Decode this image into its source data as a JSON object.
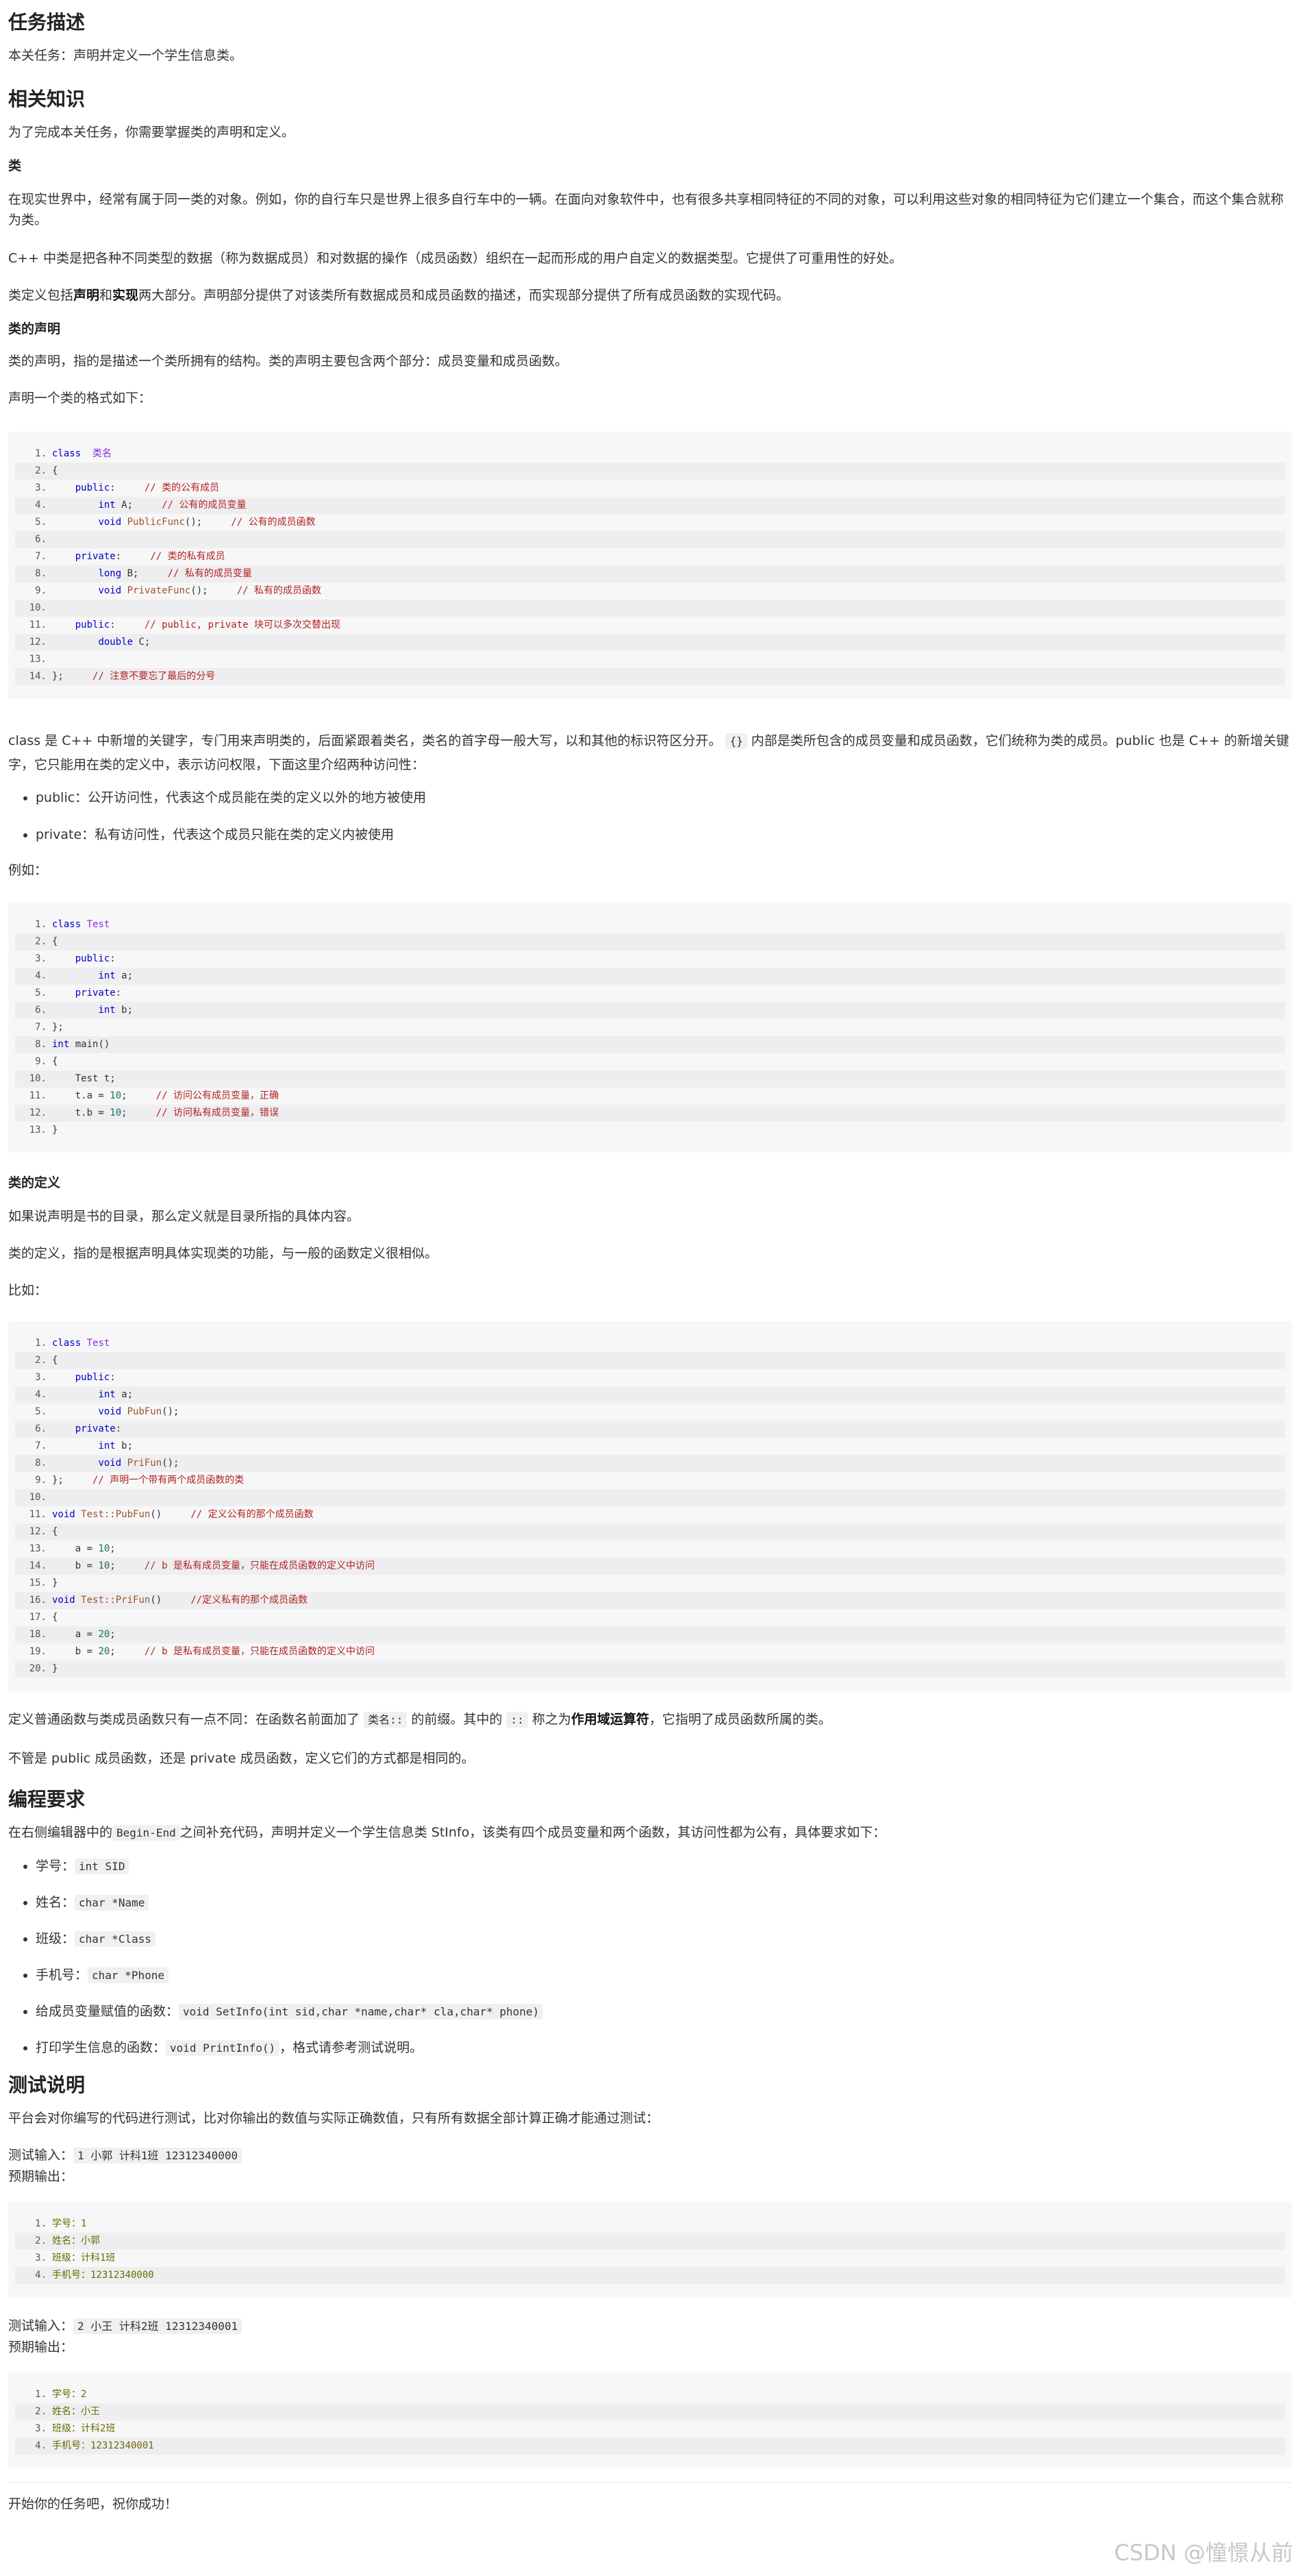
{
  "h_task": "任务描述",
  "p_task": "本关任务：声明并定义一个学生信息类。",
  "h_know": "相关知识",
  "p_know": "为了完成本关任务，你需要掌握类的声明和定义。",
  "h_class": "类",
  "p_class1": "在现实世界中，经常有属于同一类的对象。例如，你的自行车只是世界上很多自行车中的一辆。在面向对象软件中，也有很多共享相同特征的不同的对象，可以利用这些对象的相同特征为它们建立一个集合，而这个集合就称为类。",
  "p_class2": "C++ 中类是把各种不同类型的数据（称为数据成员）和对数据的操作（成员函数）组织在一起而形成的用户自定义的数据类型。它提供了可重用性的好处。",
  "p_class3a": "类定义包括",
  "p_class3b": "声明",
  "p_class3c": "和",
  "p_class3d": "实现",
  "p_class3e": "两大部分。声明部分提供了对该类所有数据成员和成员函数的描述，而实现部分提供了所有成员函数的实现代码。",
  "h_decl": "类的声明",
  "p_decl1": "类的声明，指的是描述一个类所拥有的结构。类的声明主要包含两个部分：成员变量和成员函数。",
  "p_decl2": "声明一个类的格式如下：",
  "code1": [
    {
      "n": "1.",
      "t": [
        [
          "kw",
          "class"
        ],
        [
          "",
          "  "
        ],
        [
          "ty",
          "类名"
        ]
      ]
    },
    {
      "n": "2.",
      "t": [
        [
          "",
          "{"
        ]
      ]
    },
    {
      "n": "3.",
      "t": [
        [
          "",
          "    "
        ],
        [
          "kw",
          "public"
        ],
        [
          "",
          ":     "
        ],
        [
          "cm",
          "// 类的公有成员"
        ]
      ]
    },
    {
      "n": "4.",
      "t": [
        [
          "",
          "        "
        ],
        [
          "kw",
          "int"
        ],
        [
          "",
          " A;     "
        ],
        [
          "cm",
          "// 公有的成员变量"
        ]
      ]
    },
    {
      "n": "5.",
      "t": [
        [
          "",
          "        "
        ],
        [
          "kw",
          "void"
        ],
        [
          "",
          " "
        ],
        [
          "fn",
          "PublicFunc"
        ],
        [
          "",
          "();     "
        ],
        [
          "cm",
          "// 公有的成员函数"
        ]
      ]
    },
    {
      "n": "6.",
      "t": [
        [
          "",
          ""
        ]
      ]
    },
    {
      "n": "7.",
      "t": [
        [
          "",
          "    "
        ],
        [
          "kw",
          "private"
        ],
        [
          "",
          ":     "
        ],
        [
          "cm",
          "// 类的私有成员"
        ]
      ]
    },
    {
      "n": "8.",
      "t": [
        [
          "",
          "        "
        ],
        [
          "kw",
          "long"
        ],
        [
          "",
          " B;     "
        ],
        [
          "cm",
          "// 私有的成员变量"
        ]
      ]
    },
    {
      "n": "9.",
      "t": [
        [
          "",
          "        "
        ],
        [
          "kw",
          "void"
        ],
        [
          "",
          " "
        ],
        [
          "fn",
          "PrivateFunc"
        ],
        [
          "",
          "();     "
        ],
        [
          "cm",
          "// 私有的成员函数"
        ]
      ]
    },
    {
      "n": "10.",
      "t": [
        [
          "",
          ""
        ]
      ]
    },
    {
      "n": "11.",
      "t": [
        [
          "",
          "    "
        ],
        [
          "kw",
          "public"
        ],
        [
          "",
          ":     "
        ],
        [
          "cm",
          "// public, private 块可以多次交替出现"
        ]
      ]
    },
    {
      "n": "12.",
      "t": [
        [
          "",
          "        "
        ],
        [
          "kw",
          "double"
        ],
        [
          "",
          " C;"
        ]
      ]
    },
    {
      "n": "13.",
      "t": [
        [
          "",
          ""
        ]
      ]
    },
    {
      "n": "14.",
      "t": [
        [
          "",
          "};     "
        ],
        [
          "cm",
          "// 注意不要忘了最后的分号"
        ]
      ]
    }
  ],
  "p_kw1": "class 是 C++ 中新增的关键字，专门用来声明类的，后面紧跟着类名，类名的首字母一般大写，以和其他的标识符区分开。",
  "p_kw_ic": "{}",
  "p_kw2": " 内部是类所包含的成员变量和成员函数，它们统称为类的成员。public 也是 C++ 的新增关键字，它只能用在类的定义中，表示访问权限，下面这里介绍两种访问性：",
  "li_public": "public：公开访问性，代表这个成员能在类的定义以外的地方被使用",
  "li_private": "private：私有访问性，代表这个成员只能在类的定义内被使用",
  "p_eg": "例如：",
  "code2": [
    {
      "n": "1.",
      "t": [
        [
          "kw",
          "class"
        ],
        [
          "",
          " "
        ],
        [
          "ty",
          "Test"
        ]
      ]
    },
    {
      "n": "2.",
      "t": [
        [
          "",
          "{"
        ]
      ]
    },
    {
      "n": "3.",
      "t": [
        [
          "",
          "    "
        ],
        [
          "kw",
          "public"
        ],
        [
          "",
          ":"
        ]
      ]
    },
    {
      "n": "4.",
      "t": [
        [
          "",
          "        "
        ],
        [
          "kw",
          "int"
        ],
        [
          "",
          " a;"
        ]
      ]
    },
    {
      "n": "5.",
      "t": [
        [
          "",
          "    "
        ],
        [
          "kw",
          "private"
        ],
        [
          "",
          ":"
        ]
      ]
    },
    {
      "n": "6.",
      "t": [
        [
          "",
          "        "
        ],
        [
          "kw",
          "int"
        ],
        [
          "",
          " b;"
        ]
      ]
    },
    {
      "n": "7.",
      "t": [
        [
          "",
          "};"
        ]
      ]
    },
    {
      "n": "8.",
      "t": [
        [
          "kw",
          "int"
        ],
        [
          "",
          " main()"
        ]
      ]
    },
    {
      "n": "9.",
      "t": [
        [
          "",
          "{"
        ]
      ]
    },
    {
      "n": "10.",
      "t": [
        [
          "",
          "    Test t;"
        ]
      ]
    },
    {
      "n": "11.",
      "t": [
        [
          "",
          "    t.a = "
        ],
        [
          "nm",
          "10"
        ],
        [
          "",
          ";     "
        ],
        [
          "cm",
          "// 访问公有成员变量，正确"
        ]
      ]
    },
    {
      "n": "12.",
      "t": [
        [
          "",
          "    t.b = "
        ],
        [
          "nm",
          "10"
        ],
        [
          "",
          ";     "
        ],
        [
          "cm",
          "// 访问私有成员变量，错误"
        ]
      ]
    },
    {
      "n": "13.",
      "t": [
        [
          "",
          "}"
        ]
      ]
    }
  ],
  "h_def": "类的定义",
  "p_def1": "如果说声明是书的目录，那么定义就是目录所指的具体内容。",
  "p_def2": "类的定义，指的是根据声明具体实现类的功能，与一般的函数定义很相似。",
  "p_def3": "比如：",
  "code3": [
    {
      "n": "1.",
      "t": [
        [
          "kw",
          "class"
        ],
        [
          "",
          " "
        ],
        [
          "ty",
          "Test"
        ]
      ]
    },
    {
      "n": "2.",
      "t": [
        [
          "",
          "{"
        ]
      ]
    },
    {
      "n": "3.",
      "t": [
        [
          "",
          "    "
        ],
        [
          "kw",
          "public"
        ],
        [
          "",
          ":"
        ]
      ]
    },
    {
      "n": "4.",
      "t": [
        [
          "",
          "        "
        ],
        [
          "kw",
          "int"
        ],
        [
          "",
          " a;"
        ]
      ]
    },
    {
      "n": "5.",
      "t": [
        [
          "",
          "        "
        ],
        [
          "kw",
          "void"
        ],
        [
          "",
          " "
        ],
        [
          "fn",
          "PubFun"
        ],
        [
          "",
          "();"
        ]
      ]
    },
    {
      "n": "6.",
      "t": [
        [
          "",
          "    "
        ],
        [
          "kw",
          "private"
        ],
        [
          "",
          ":"
        ]
      ]
    },
    {
      "n": "7.",
      "t": [
        [
          "",
          "        "
        ],
        [
          "kw",
          "int"
        ],
        [
          "",
          " b;"
        ]
      ]
    },
    {
      "n": "8.",
      "t": [
        [
          "",
          "        "
        ],
        [
          "kw",
          "void"
        ],
        [
          "",
          " "
        ],
        [
          "fn",
          "PriFun"
        ],
        [
          "",
          "();"
        ]
      ]
    },
    {
      "n": "9.",
      "t": [
        [
          "",
          "};     "
        ],
        [
          "cm",
          "// 声明一个带有两个成员函数的类"
        ]
      ]
    },
    {
      "n": "10.",
      "t": [
        [
          "",
          ""
        ]
      ]
    },
    {
      "n": "11.",
      "t": [
        [
          "kw",
          "void"
        ],
        [
          "",
          " "
        ],
        [
          "fn",
          "Test::PubFun"
        ],
        [
          "",
          "()     "
        ],
        [
          "cm",
          "// 定义公有的那个成员函数"
        ]
      ]
    },
    {
      "n": "12.",
      "t": [
        [
          "",
          "{"
        ]
      ]
    },
    {
      "n": "13.",
      "t": [
        [
          "",
          "    a = "
        ],
        [
          "nm",
          "10"
        ],
        [
          "",
          ";"
        ]
      ]
    },
    {
      "n": "14.",
      "t": [
        [
          "",
          "    b = "
        ],
        [
          "nm",
          "10"
        ],
        [
          "",
          ";     "
        ],
        [
          "cm",
          "// b 是私有成员变量，只能在成员函数的定义中访问"
        ]
      ]
    },
    {
      "n": "15.",
      "t": [
        [
          "",
          "}"
        ]
      ]
    },
    {
      "n": "16.",
      "t": [
        [
          "kw",
          "void"
        ],
        [
          "",
          " "
        ],
        [
          "fn",
          "Test::PriFun"
        ],
        [
          "",
          "()     "
        ],
        [
          "cm",
          "//定义私有的那个成员函数"
        ]
      ]
    },
    {
      "n": "17.",
      "t": [
        [
          "",
          "{"
        ]
      ]
    },
    {
      "n": "18.",
      "t": [
        [
          "",
          "    a = "
        ],
        [
          "nm",
          "20"
        ],
        [
          "",
          ";"
        ]
      ]
    },
    {
      "n": "19.",
      "t": [
        [
          "",
          "    b = "
        ],
        [
          "nm",
          "20"
        ],
        [
          "",
          ";     "
        ],
        [
          "cm",
          "// b 是私有成员变量，只能在成员函数的定义中访问"
        ]
      ]
    },
    {
      "n": "20.",
      "t": [
        [
          "",
          "}"
        ]
      ]
    }
  ],
  "p_scope1": "定义普通函数与类成员函数只有一点不同：在函数名前面加了",
  "p_scope_ic1": "类名::",
  "p_scope2": "的前缀。其中的",
  "p_scope_ic2": "::",
  "p_scope3": "称之为",
  "p_scope_b": "作用域运算符",
  "p_scope4": "，它指明了成员函数所属的类。",
  "p_scope5": "不管是 public 成员函数，还是 private 成员函数，定义它们的方式都是相同的。",
  "h_req": "编程要求",
  "p_req1": "在右侧编辑器中的",
  "p_req_ic": "Begin-End",
  "p_req2": "之间补充代码，声明并定义一个学生信息类 StInfo，该类有四个成员变量和两个函数，其访问性都为公有，具体要求如下：",
  "req_items": [
    {
      "label": "学号：",
      "code": "int SID",
      "tail": ""
    },
    {
      "label": "姓名：",
      "code": "char *Name",
      "tail": ""
    },
    {
      "label": "班级：",
      "code": "char *Class",
      "tail": ""
    },
    {
      "label": "手机号：",
      "code": "char *Phone",
      "tail": ""
    },
    {
      "label": "给成员变量赋值的函数：",
      "code": "void SetInfo(int sid,char *name,char* cla,char* phone)",
      "tail": ""
    },
    {
      "label": "打印学生信息的函数：",
      "code": "void PrintInfo()",
      "tail": "，格式请参考测试说明。"
    }
  ],
  "h_test": "测试说明",
  "p_test": "平台会对你编写的代码进行测试，比对你输出的数值与实际正确数值，只有所有数据全部计算正确才能通过测试：",
  "t_in_label": "测试输入：",
  "t_out_label": "预期输出：",
  "test1_in": "1 小郭 计科1班 12312340000",
  "test1_out": [
    "学号：1",
    "姓名：小郭",
    "班级：计科1班",
    "手机号：12312340000"
  ],
  "test2_in": "2 小王 计科2班 12312340001",
  "test2_out": [
    "学号：2",
    "姓名：小王",
    "班级：计科2班",
    "手机号：12312340001"
  ],
  "p_end": "开始你的任务吧，祝你成功！",
  "watermark": "CSDN @憧憬从前"
}
